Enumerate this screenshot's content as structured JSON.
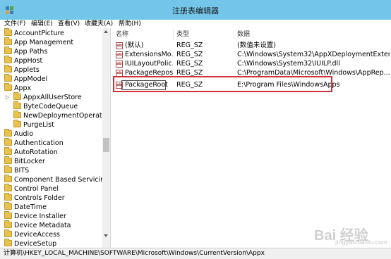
{
  "window": {
    "title": "注册表编辑器"
  },
  "menu": [
    "文件(F)",
    "编辑(E)",
    "查看(V)",
    "收藏夹(A)",
    "帮助(H)"
  ],
  "tree": [
    {
      "label": "AccountPicture"
    },
    {
      "label": "App Management"
    },
    {
      "label": "App Paths"
    },
    {
      "label": "AppHost"
    },
    {
      "label": "Applets"
    },
    {
      "label": "AppModel"
    },
    {
      "label": "Appx"
    },
    {
      "label": "AppxAllUserStore"
    },
    {
      "label": "ByteCodeQueue"
    },
    {
      "label": "NewDeploymentOperation"
    },
    {
      "label": "PurgeList"
    },
    {
      "label": "Audio"
    },
    {
      "label": "Authentication"
    },
    {
      "label": "AutoRotation"
    },
    {
      "label": "BitLocker"
    },
    {
      "label": "BITS"
    },
    {
      "label": "Component Based Servicing"
    },
    {
      "label": "Control Panel"
    },
    {
      "label": "Controls Folder"
    },
    {
      "label": "DateTime"
    },
    {
      "label": "Device Installer"
    },
    {
      "label": "Device Metadata"
    },
    {
      "label": "DeviceAccess"
    },
    {
      "label": "DeviceSetup"
    }
  ],
  "columns": {
    "name": "名称",
    "type": "类型",
    "data": "数据"
  },
  "rows": [
    {
      "name": "(默认)",
      "type": "REG_SZ",
      "data": "(数值未设置)"
    },
    {
      "name": "ExtensionsMo...",
      "type": "REG_SZ",
      "data": "C:\\Windows\\System32\\AppXDeploymentExten..."
    },
    {
      "name": "IUILayoutPolic...",
      "type": "REG_SZ",
      "data": "C:\\Windows\\System32\\IUILP.dll"
    },
    {
      "name": "PackageRepos...",
      "type": "REG_SZ",
      "data": "C:\\ProgramData\\Microsoft\\Windows\\AppRep..."
    },
    {
      "name": "PackageRoot",
      "type": "REG_SZ",
      "data": "E:\\Program Files\\WindowsApps"
    }
  ],
  "status": "计算机\\HKEY_LOCAL_MACHINE\\SOFTWARE\\Microsoft\\Windows\\CurrentVersion\\Appx",
  "watermark": {
    "brand": "Bai 经验",
    "url": "jingyan.baidu.com"
  },
  "colors": {
    "titlebar": "#74c6e8",
    "highlight": "#d0313a",
    "folder": "#e8c24e"
  }
}
